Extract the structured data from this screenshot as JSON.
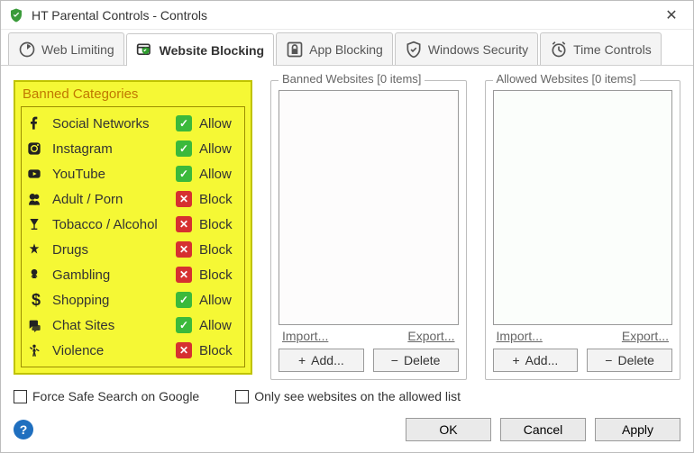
{
  "window": {
    "title": "HT Parental Controls - Controls"
  },
  "tabs": [
    {
      "label": "Web Limiting",
      "active": false
    },
    {
      "label": "Website Blocking",
      "active": true
    },
    {
      "label": "App Blocking",
      "active": false
    },
    {
      "label": "Windows Security",
      "active": false
    },
    {
      "label": "Time Controls",
      "active": false
    }
  ],
  "banned_categories": {
    "title": "Banned Categories",
    "items": [
      {
        "icon": "facebook",
        "name": "Social Networks",
        "status": "Allow"
      },
      {
        "icon": "instagram",
        "name": "Instagram",
        "status": "Allow"
      },
      {
        "icon": "youtube",
        "name": "YouTube",
        "status": "Allow"
      },
      {
        "icon": "adult",
        "name": "Adult / Porn",
        "status": "Block"
      },
      {
        "icon": "alcohol",
        "name": "Tobacco / Alcohol",
        "status": "Block"
      },
      {
        "icon": "drugs",
        "name": "Drugs",
        "status": "Block"
      },
      {
        "icon": "gambling",
        "name": "Gambling",
        "status": "Block"
      },
      {
        "icon": "shopping",
        "name": "Shopping",
        "status": "Allow"
      },
      {
        "icon": "chat",
        "name": "Chat Sites",
        "status": "Allow"
      },
      {
        "icon": "violence",
        "name": "Violence",
        "status": "Block"
      }
    ]
  },
  "banned_websites": {
    "title": "Banned Websites [0 items]",
    "import": "Import...",
    "export": "Export...",
    "add": "Add...",
    "delete": "Delete"
  },
  "allowed_websites": {
    "title": "Allowed Websites [0 items]",
    "import": "Import...",
    "export": "Export...",
    "add": "Add...",
    "delete": "Delete"
  },
  "checks": {
    "safe_search": "Force Safe Search on Google",
    "allowed_only": "Only see websites on the allowed list"
  },
  "buttons": {
    "ok": "OK",
    "cancel": "Cancel",
    "apply": "Apply"
  }
}
